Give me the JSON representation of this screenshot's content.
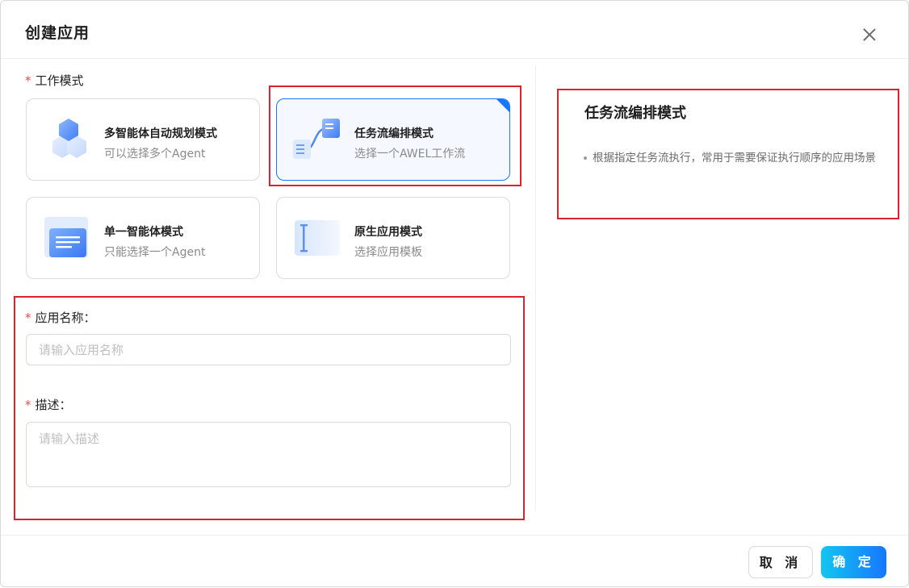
{
  "dialog": {
    "title": "创建应用"
  },
  "form": {
    "mode_label": "工作模式",
    "name_label": "应用名称：",
    "name_placeholder": "请输入应用名称",
    "desc_label": "描述：",
    "desc_placeholder": "请输入描述",
    "required_mark": "*"
  },
  "modes": [
    {
      "title": "多智能体自动规划模式",
      "subtitle": "可以选择多个Agent",
      "icon": "hexagon-cluster-icon",
      "selected": false
    },
    {
      "title": "任务流编排模式",
      "subtitle": "选择一个AWEL工作流",
      "icon": "workflow-icon",
      "selected": true
    },
    {
      "title": "单一智能体模式",
      "subtitle": "只能选择一个Agent",
      "icon": "document-stack-icon",
      "selected": false
    },
    {
      "title": "原生应用模式",
      "subtitle": "选择应用模板",
      "icon": "text-cursor-icon",
      "selected": false
    }
  ],
  "detail": {
    "title": "任务流编排模式",
    "description": "根据指定任务流执行，常用于需要保证执行顺序的应用场景"
  },
  "footer": {
    "cancel_label": "取 消",
    "ok_label": "确 定"
  },
  "colors": {
    "accent": "#1677ff",
    "required": "#f04848",
    "highlight_box": "#d9232e"
  }
}
